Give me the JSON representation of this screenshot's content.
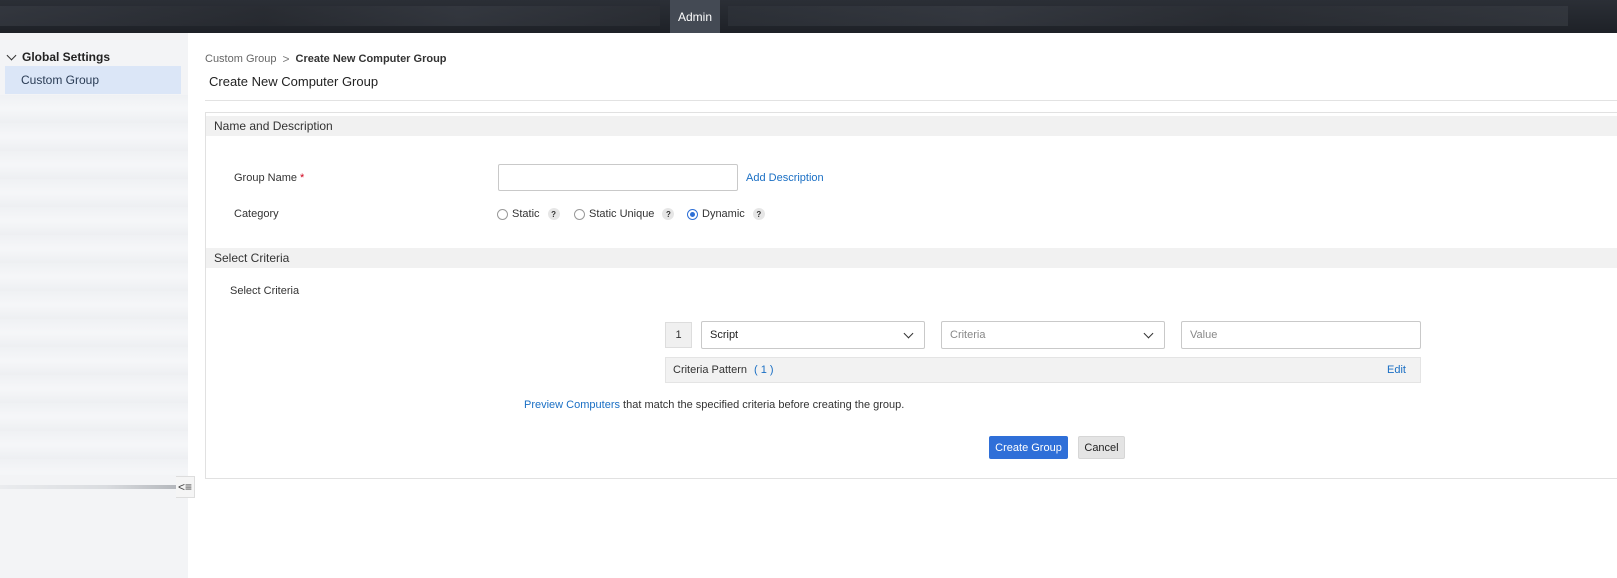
{
  "topbar": {
    "active_tab": "Admin"
  },
  "sidebar": {
    "heading": "Global Settings",
    "items": [
      {
        "label": "Custom Group",
        "selected": true
      }
    ],
    "collapse_icon": "collapse-sidebar-icon"
  },
  "breadcrumb": {
    "parent": "Custom Group",
    "separator": ">",
    "current": "Create New Computer Group"
  },
  "page": {
    "title": "Create New Computer Group"
  },
  "name_section": {
    "heading": "Name and Description",
    "group_name_label": "Group Name",
    "required_mark": "*",
    "group_name_value": "",
    "add_description_link": "Add Description",
    "category_label": "Category",
    "category_options": [
      {
        "label": "Static",
        "selected": false,
        "help": "?"
      },
      {
        "label": "Static Unique",
        "selected": false,
        "help": "?"
      },
      {
        "label": "Dynamic",
        "selected": true,
        "help": "?"
      }
    ]
  },
  "criteria_section": {
    "heading": "Select Criteria",
    "label": "Select Criteria",
    "row_number": "1",
    "field_select": "Script",
    "criteria_placeholder": "Criteria",
    "value_placeholder": "Value",
    "pattern_label": "Criteria Pattern",
    "pattern_value": "( 1 )",
    "edit_link": "Edit"
  },
  "preview": {
    "link": "Preview Computers",
    "text": "that match the specified criteria before creating the group."
  },
  "actions": {
    "create_label": "Create Group",
    "cancel_label": "Cancel"
  },
  "colors": {
    "accent": "#2f6fd8",
    "link": "#1a6fc4",
    "topbar": "#1e2127",
    "sidebar_selected": "#dbe6f7"
  }
}
